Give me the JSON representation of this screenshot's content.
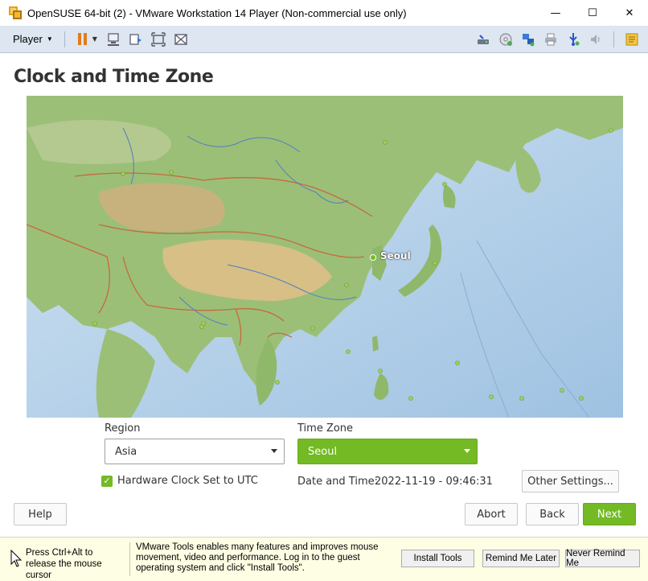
{
  "window": {
    "title": "OpenSUSE 64-bit (2) - VMware Workstation 14 Player (Non-commercial use only)",
    "minimize_glyph": "—",
    "maximize_glyph": "☐",
    "close_glyph": "✕"
  },
  "vmware_toolbar": {
    "player_menu_label": "Player",
    "icons_left": [
      "pause-icon",
      "send-ctrl-alt-del-icon",
      "removable-devices-icon",
      "full-screen-icon",
      "unity-icon"
    ],
    "icons_right": [
      "hard-disk-icon",
      "cd-drive-icon",
      "network-adapter-icon",
      "printer-icon",
      "usb-icon",
      "sound-icon",
      "message-log-icon"
    ]
  },
  "installer": {
    "title": "Clock and Time Zone",
    "map": {
      "selected_city": "Seoul",
      "colors": {
        "ocean": "#b7d3ea",
        "land": "#8fb86a",
        "desert": "#d9c28a",
        "borders": "#c46a3b",
        "rivers": "#4f7ec1",
        "marker": "#9bd250"
      }
    },
    "region": {
      "label": "Region",
      "value": "Asia"
    },
    "timezone": {
      "label": "Time Zone",
      "value": "Seoul"
    },
    "hardware_clock": {
      "label": "Hardware Clock Set to UTC",
      "checked": true
    },
    "datetime": {
      "label": "Date and Time:",
      "value": "2022-11-19 - 09:46:31"
    },
    "buttons": {
      "other_settings": "Other Settings...",
      "help": "Help",
      "abort": "Abort",
      "back": "Back",
      "next": "Next"
    },
    "accent_color": "#73ba25"
  },
  "hintbar": {
    "release_text": "Press Ctrl+Alt to release the mouse cursor",
    "tools_message": "VMware Tools enables many features and improves mouse movement, video and performance. Log in to the guest operating system and click \"Install Tools\".",
    "install_tools": "Install Tools",
    "remind_later": "Remind Me Later",
    "never_remind": "Never Remind Me"
  }
}
